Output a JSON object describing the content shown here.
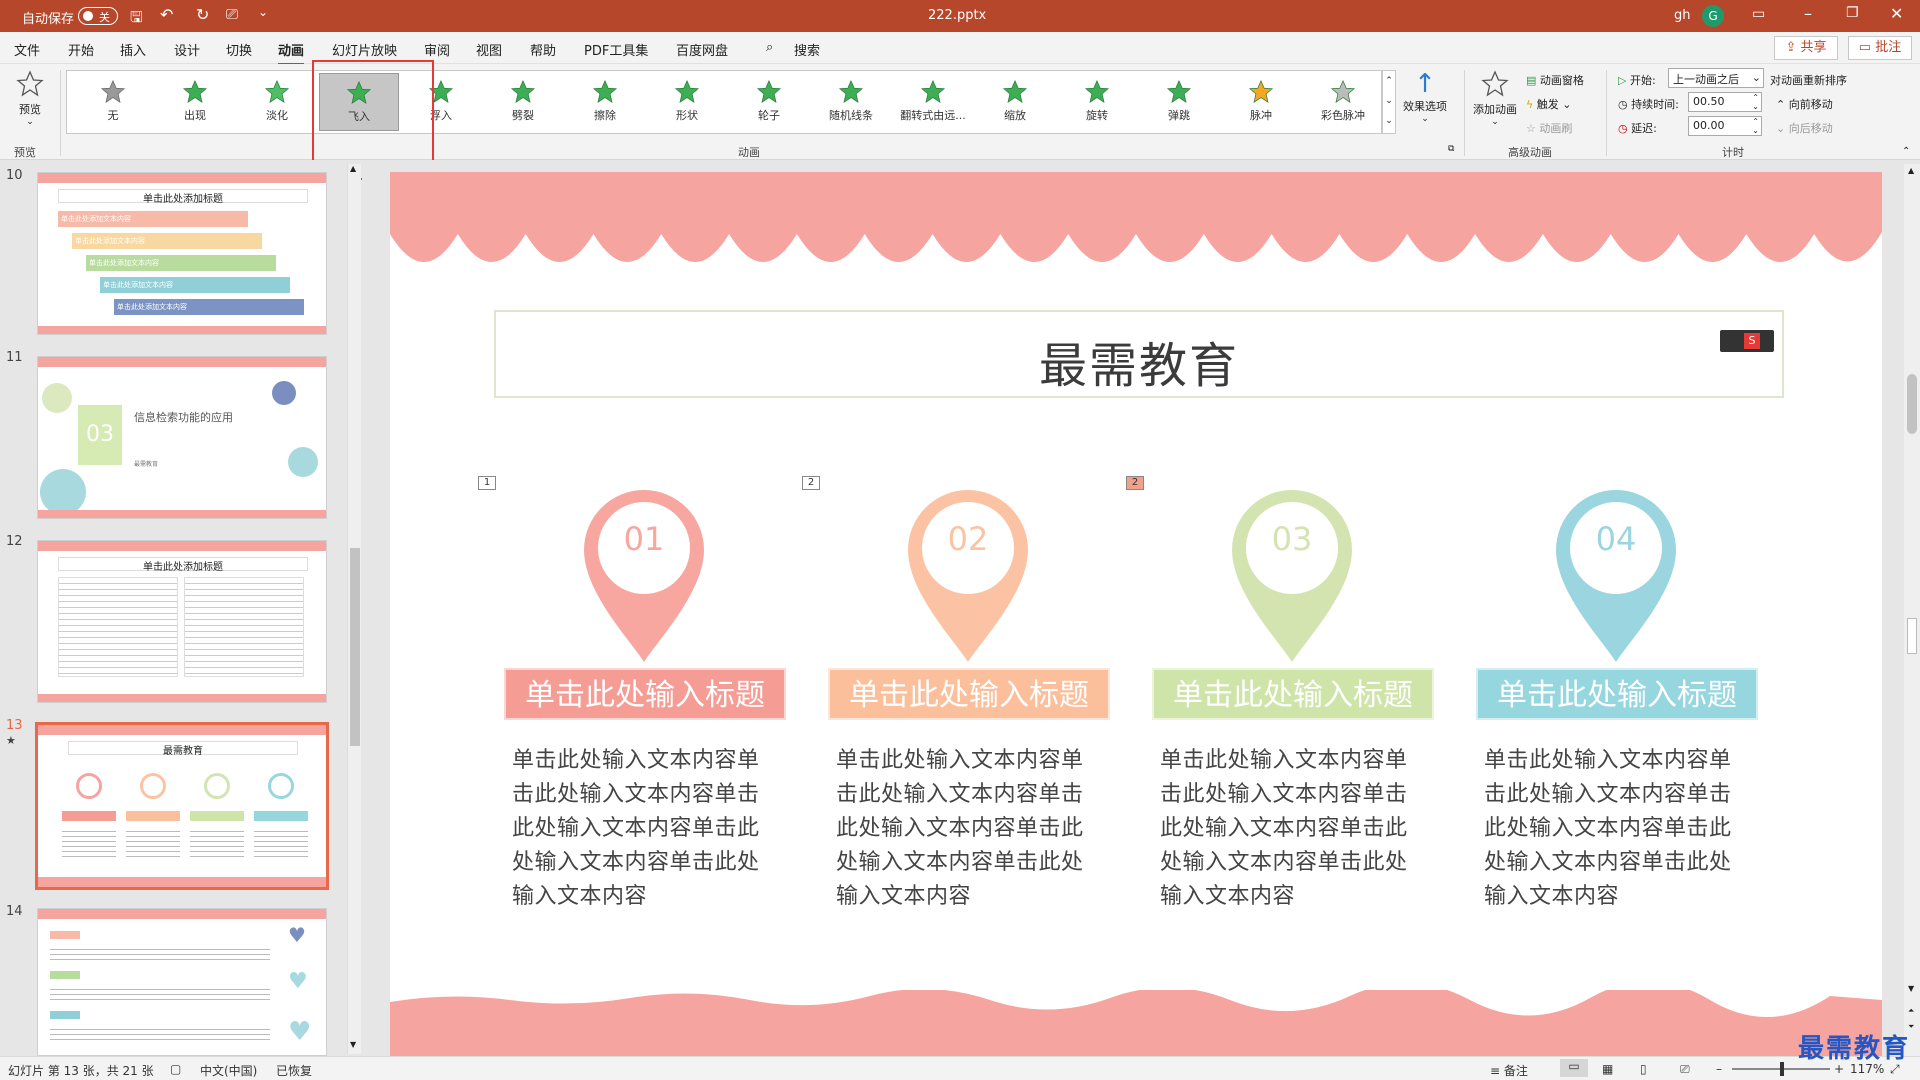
{
  "titlebar": {
    "autosave": "自动保存",
    "autosave_state": "关",
    "filename": "222.pptx",
    "user": "gh",
    "user_initial": "G"
  },
  "menu": [
    "文件",
    "开始",
    "插入",
    "设计",
    "切换",
    "动画",
    "幻灯片放映",
    "审阅",
    "视图",
    "帮助",
    "PDF工具集",
    "百度网盘"
  ],
  "search_label": "搜索",
  "share_label": "共享",
  "comment_label": "批注",
  "ribbon": {
    "preview": "预览",
    "preview_group": "预览",
    "animations": [
      {
        "label": "无",
        "icon": "none-icon"
      },
      {
        "label": "出现",
        "icon": "appear-icon"
      },
      {
        "label": "淡化",
        "icon": "fade-icon"
      },
      {
        "label": "飞入",
        "icon": "fly-in-icon"
      },
      {
        "label": "浮入",
        "icon": "float-in-icon"
      },
      {
        "label": "劈裂",
        "icon": "split-icon"
      },
      {
        "label": "擦除",
        "icon": "wipe-icon"
      },
      {
        "label": "形状",
        "icon": "shape-icon"
      },
      {
        "label": "轮子",
        "icon": "wheel-icon"
      },
      {
        "label": "随机线条",
        "icon": "random-bars-icon"
      },
      {
        "label": "翻转式由远...",
        "icon": "grow-turn-icon"
      },
      {
        "label": "缩放",
        "icon": "zoom-icon"
      },
      {
        "label": "旋转",
        "icon": "swivel-icon"
      },
      {
        "label": "弹跳",
        "icon": "bounce-icon"
      },
      {
        "label": "脉冲",
        "icon": "pulse-icon"
      },
      {
        "label": "彩色脉冲",
        "icon": "color-pulse-icon"
      }
    ],
    "effect_options": "效果选项",
    "animation_group": "动画",
    "add_animation": "添加动画",
    "animation_pane": "动画窗格",
    "trigger": "触发",
    "animation_painter": "动画刷",
    "advanced_group": "高级动画",
    "start_label": "开始:",
    "start_value": "上一动画之后",
    "duration_label": "持续时间:",
    "duration_value": "00.50",
    "delay_label": "延迟:",
    "delay_value": "00.00",
    "timing_group": "计时",
    "reorder_title": "对动画重新排序",
    "move_earlier": "向前移动",
    "move_later": "向后移动"
  },
  "thumbnails": [
    {
      "num": "10",
      "title": "单击此处添加标题",
      "rows": [
        "单击此处添加文本内容",
        "单击此处添加文本内容",
        "单击此处添加文本内容",
        "单击此处添加文本内容",
        "单击此处添加文本内容"
      ]
    },
    {
      "num": "11",
      "badge": "03",
      "text": "信息检索功能的应用",
      "sub": "最需教育"
    },
    {
      "num": "12",
      "title": "单击此处添加标题"
    },
    {
      "num": "13",
      "title": "最需教育",
      "star": "★"
    },
    {
      "num": "14"
    }
  ],
  "slide": {
    "title": "最需教育",
    "tags": [
      "1",
      "2",
      "2"
    ],
    "cards": [
      {
        "num": "01",
        "title": "单击此处输入标题",
        "color": "#f59c95",
        "pin": "#f7a7a0",
        "text": "单击此处输入文本内容单击此处输入文本内容单击此处输入文本内容单击此处输入文本内容单击此处输入文本内容"
      },
      {
        "num": "02",
        "title": "单击此处输入标题",
        "color": "#fbbf9c",
        "pin": "#fbc3a3",
        "text": "单击此处输入文本内容单击此处输入文本内容单击此处输入文本内容单击此处输入文本内容单击此处输入文本内容"
      },
      {
        "num": "03",
        "title": "单击此处输入标题",
        "color": "#cfe4a8",
        "pin": "#d3e4b0",
        "text": "单击此处输入文本内容单击此处输入文本内容单击此处输入文本内容单击此处输入文本内容单击此处输入文本内容"
      },
      {
        "num": "04",
        "title": "单击此处输入标题",
        "color": "#95d6df",
        "pin": "#9bd5df",
        "text": "单击此处输入文本内容单击此处输入文本内容单击此处输入文本内容单击此处输入文本内容单击此处输入文本内容"
      }
    ]
  },
  "status": {
    "slide_info": "幻灯片 第 13 张，共 21 张",
    "language": "中文(中国)",
    "recovered": "已恢复",
    "notes": "备注",
    "zoom": "117%"
  },
  "watermark": "最需教育",
  "colors": {
    "accent": "#b7472a",
    "scallop": "#f6a4a0",
    "highlight": "#e8694a"
  }
}
